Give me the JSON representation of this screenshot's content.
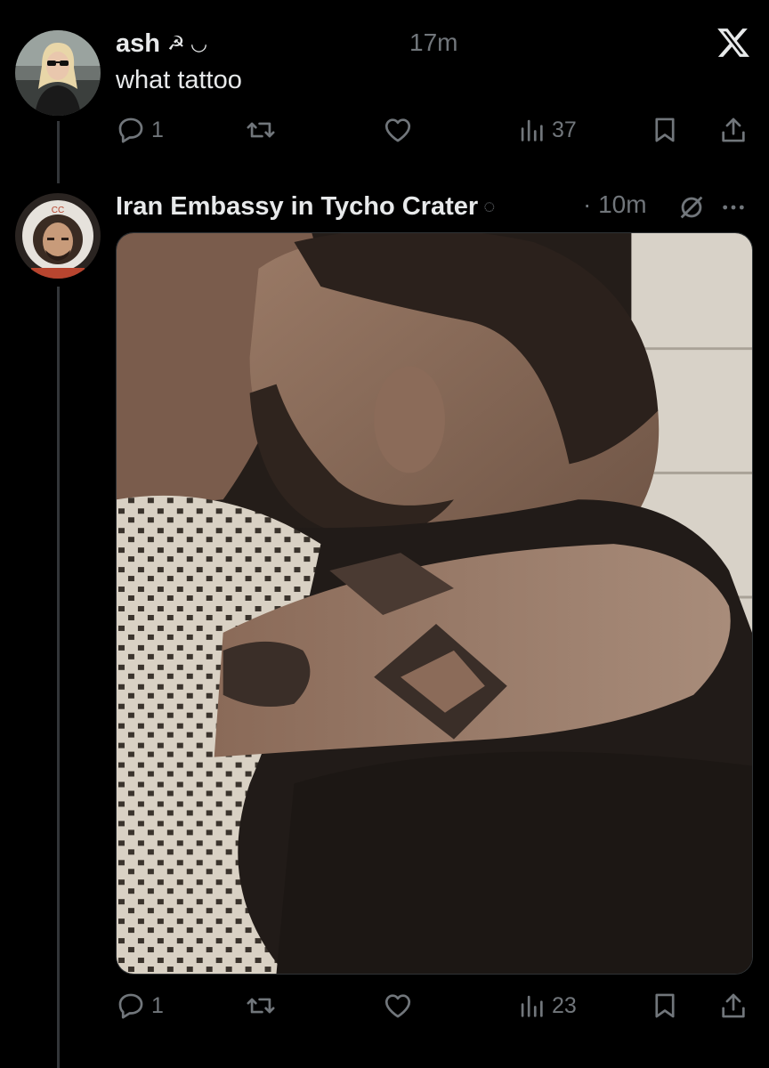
{
  "thread": {
    "reply": {
      "author": {
        "name": "ash",
        "symbols": "☭ ◡"
      },
      "time": "17m",
      "text": "what tattoo",
      "stats": {
        "replies": "1",
        "retweets": "",
        "likes": "",
        "views": "37"
      }
    },
    "original": {
      "author": {
        "name": "Iran Embassy in Tycho Crater",
        "symbols": "◌"
      },
      "time": "· 10m",
      "media_alt": "photo",
      "stats": {
        "replies": "1",
        "retweets": "",
        "likes": "",
        "views": "23"
      }
    }
  },
  "icons": {
    "platform": "x-logo-icon",
    "reply": "speech-bubble-icon",
    "retweet": "retweet-arrows-icon",
    "like": "heart-icon",
    "views": "bar-chart-icon",
    "bookmark": "bookmark-icon",
    "share": "share-upload-icon",
    "more": "ellipsis-icon"
  },
  "colors": {
    "background": "#000000",
    "text": "#e7e9ea",
    "muted": "#71767b",
    "thread_line": "#333639"
  }
}
